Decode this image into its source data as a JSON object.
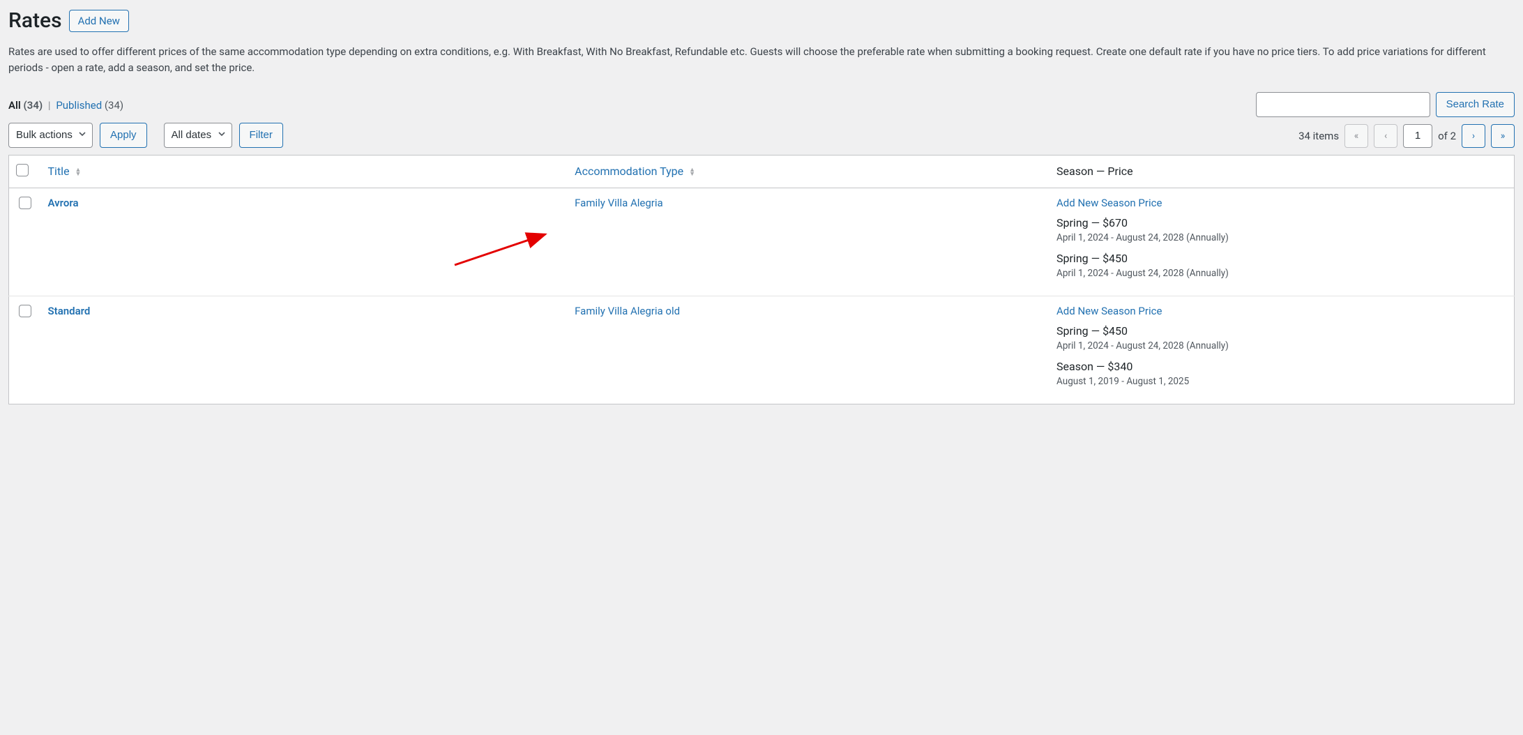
{
  "header": {
    "title": "Rates",
    "add_new": "Add New"
  },
  "description": "Rates are used to offer different prices of the same accommodation type depending on extra conditions, e.g. With Breakfast, With No Breakfast, Refundable etc. Guests will choose the preferable rate when submitting a booking request. Create one default rate if you have no price tiers. To add price variations for different periods - open a rate, add a season, and set the price.",
  "filters": {
    "all_label": "All",
    "all_count": "(34)",
    "published_label": "Published",
    "published_count": "(34)"
  },
  "tablenav": {
    "bulk_actions": "Bulk actions",
    "apply": "Apply",
    "all_dates": "All dates",
    "filter": "Filter"
  },
  "search": {
    "button": "Search Rate"
  },
  "pagination": {
    "items_text": "34 items",
    "current_page": "1",
    "of": "of 2"
  },
  "columns": {
    "title": "Title",
    "accommodation": "Accommodation Type",
    "season_price": "Season — Price"
  },
  "rows": [
    {
      "title": "Avrora",
      "accommodation": "Family Villa Alegria",
      "add_new_season": "Add New Season Price",
      "seasons": [
        {
          "line": "Spring — $670",
          "dates": "April 1, 2024 - August 24, 2028 (Annually)"
        },
        {
          "line": "Spring — $450",
          "dates": "April 1, 2024 - August 24, 2028 (Annually)"
        }
      ]
    },
    {
      "title": "Standard",
      "accommodation": "Family Villa Alegria old",
      "add_new_season": "Add New Season Price",
      "seasons": [
        {
          "line": "Spring — $450",
          "dates": "April 1, 2024 - August 24, 2028 (Annually)"
        },
        {
          "line": "Season — $340",
          "dates": "August 1, 2019 - August 1, 2025"
        }
      ]
    }
  ]
}
